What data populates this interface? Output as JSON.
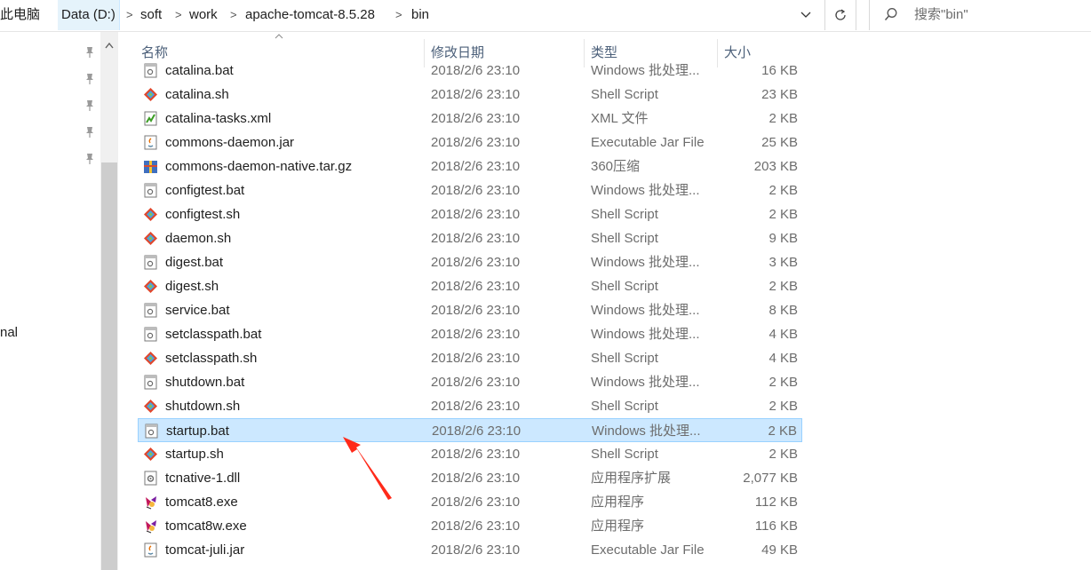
{
  "address": {
    "pc_label": "此电脑",
    "drive_label": "Data (D:)",
    "path": [
      "soft",
      "work",
      "apache-tomcat-8.5.28",
      "bin"
    ],
    "separator": ">",
    "dropdown_icon": "chevron-down-icon",
    "refresh_icon": "refresh-icon"
  },
  "search": {
    "placeholder": "搜索\"bin\""
  },
  "nav": {
    "partial_item": "nal"
  },
  "columns": {
    "name": "名称",
    "date": "修改日期",
    "type": "类型",
    "size": "大小"
  },
  "files": [
    {
      "name": "catalina.bat",
      "date": "2018/2/6 23:10",
      "type": "Windows 批处理...",
      "size": "16 KB",
      "icon": "bat"
    },
    {
      "name": "catalina.sh",
      "date": "2018/2/6 23:10",
      "type": "Shell Script",
      "size": "23 KB",
      "icon": "sh"
    },
    {
      "name": "catalina-tasks.xml",
      "date": "2018/2/6 23:10",
      "type": "XML 文件",
      "size": "2 KB",
      "icon": "xml"
    },
    {
      "name": "commons-daemon.jar",
      "date": "2018/2/6 23:10",
      "type": "Executable Jar File",
      "size": "25 KB",
      "icon": "jar"
    },
    {
      "name": "commons-daemon-native.tar.gz",
      "date": "2018/2/6 23:10",
      "type": "360压缩",
      "size": "203 KB",
      "icon": "archive"
    },
    {
      "name": "configtest.bat",
      "date": "2018/2/6 23:10",
      "type": "Windows 批处理...",
      "size": "2 KB",
      "icon": "bat"
    },
    {
      "name": "configtest.sh",
      "date": "2018/2/6 23:10",
      "type": "Shell Script",
      "size": "2 KB",
      "icon": "sh"
    },
    {
      "name": "daemon.sh",
      "date": "2018/2/6 23:10",
      "type": "Shell Script",
      "size": "9 KB",
      "icon": "sh"
    },
    {
      "name": "digest.bat",
      "date": "2018/2/6 23:10",
      "type": "Windows 批处理...",
      "size": "3 KB",
      "icon": "bat"
    },
    {
      "name": "digest.sh",
      "date": "2018/2/6 23:10",
      "type": "Shell Script",
      "size": "2 KB",
      "icon": "sh"
    },
    {
      "name": "service.bat",
      "date": "2018/2/6 23:10",
      "type": "Windows 批处理...",
      "size": "8 KB",
      "icon": "bat"
    },
    {
      "name": "setclasspath.bat",
      "date": "2018/2/6 23:10",
      "type": "Windows 批处理...",
      "size": "4 KB",
      "icon": "bat"
    },
    {
      "name": "setclasspath.sh",
      "date": "2018/2/6 23:10",
      "type": "Shell Script",
      "size": "4 KB",
      "icon": "sh"
    },
    {
      "name": "shutdown.bat",
      "date": "2018/2/6 23:10",
      "type": "Windows 批处理...",
      "size": "2 KB",
      "icon": "bat"
    },
    {
      "name": "shutdown.sh",
      "date": "2018/2/6 23:10",
      "type": "Shell Script",
      "size": "2 KB",
      "icon": "sh"
    },
    {
      "name": "startup.bat",
      "date": "2018/2/6 23:10",
      "type": "Windows 批处理...",
      "size": "2 KB",
      "icon": "bat",
      "selected": true
    },
    {
      "name": "startup.sh",
      "date": "2018/2/6 23:10",
      "type": "Shell Script",
      "size": "2 KB",
      "icon": "sh"
    },
    {
      "name": "tcnative-1.dll",
      "date": "2018/2/6 23:10",
      "type": "应用程序扩展",
      "size": "2,077 KB",
      "icon": "dll"
    },
    {
      "name": "tomcat8.exe",
      "date": "2018/2/6 23:10",
      "type": "应用程序",
      "size": "112 KB",
      "icon": "exe"
    },
    {
      "name": "tomcat8w.exe",
      "date": "2018/2/6 23:10",
      "type": "应用程序",
      "size": "116 KB",
      "icon": "exe"
    },
    {
      "name": "tomcat-juli.jar",
      "date": "2018/2/6 23:10",
      "type": "Executable Jar File",
      "size": "49 KB",
      "icon": "jar"
    }
  ],
  "colors": {
    "selection_bg": "#cce8ff",
    "selection_border": "#99d1ff",
    "annotation_arrow": "#ff2a1a"
  }
}
